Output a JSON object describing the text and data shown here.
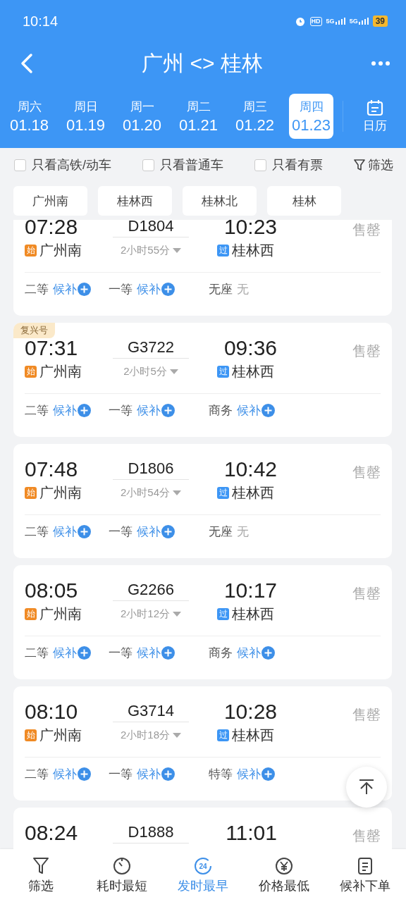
{
  "status_bar": {
    "time": "10:14",
    "icons": [
      {
        "kind": "alarm"
      },
      {
        "kind": "hd",
        "text": "HD"
      },
      {
        "kind": "signal",
        "text": "5G"
      },
      {
        "kind": "signal",
        "text": "5G"
      }
    ],
    "battery": "39"
  },
  "header": {
    "title": "广州 <> 桂林"
  },
  "dates": [
    {
      "weekday": "周六",
      "date": "01.18",
      "selected": false
    },
    {
      "weekday": "周日",
      "date": "01.19",
      "selected": false
    },
    {
      "weekday": "周一",
      "date": "01.20",
      "selected": false
    },
    {
      "weekday": "周二",
      "date": "01.21",
      "selected": false
    },
    {
      "weekday": "周三",
      "date": "01.22",
      "selected": false
    },
    {
      "weekday": "周四",
      "date": "01.23",
      "selected": true
    }
  ],
  "calendar_button": {
    "label": "日历"
  },
  "filters": [
    {
      "label": "只看高铁/动车",
      "checked": false
    },
    {
      "label": "只看普通车",
      "checked": false
    },
    {
      "label": "只看有票",
      "checked": false
    }
  ],
  "filter_button": {
    "label": "筛选"
  },
  "stations": [
    "广州南",
    "桂林西",
    "桂林北",
    "桂林"
  ],
  "trains": [
    {
      "dep_time": "07:28",
      "train_no": "D1804",
      "arr_time": "10:23",
      "status": "售罄",
      "from_tag": "始",
      "from_station": "广州南",
      "duration": "2小时55分",
      "to_tag": "过",
      "to_station": "桂林西",
      "seats": [
        {
          "class": "二等",
          "status": "候补",
          "kind": "waitlist"
        },
        {
          "class": "一等",
          "status": "候补",
          "kind": "waitlist"
        },
        {
          "class": "无座",
          "status": "无",
          "kind": "none"
        }
      ]
    },
    {
      "badge": "复兴号",
      "dep_time": "07:31",
      "train_no": "G3722",
      "arr_time": "09:36",
      "status": "售罄",
      "from_tag": "始",
      "from_station": "广州南",
      "duration": "2小时5分",
      "to_tag": "过",
      "to_station": "桂林西",
      "seats": [
        {
          "class": "二等",
          "status": "候补",
          "kind": "waitlist"
        },
        {
          "class": "一等",
          "status": "候补",
          "kind": "waitlist"
        },
        {
          "class": "商务",
          "status": "候补",
          "kind": "waitlist"
        }
      ]
    },
    {
      "dep_time": "07:48",
      "train_no": "D1806",
      "arr_time": "10:42",
      "status": "售罄",
      "from_tag": "始",
      "from_station": "广州南",
      "duration": "2小时54分",
      "to_tag": "过",
      "to_station": "桂林西",
      "seats": [
        {
          "class": "二等",
          "status": "候补",
          "kind": "waitlist"
        },
        {
          "class": "一等",
          "status": "候补",
          "kind": "waitlist"
        },
        {
          "class": "无座",
          "status": "无",
          "kind": "none"
        }
      ]
    },
    {
      "dep_time": "08:05",
      "train_no": "G2266",
      "arr_time": "10:17",
      "status": "售罄",
      "from_tag": "始",
      "from_station": "广州南",
      "duration": "2小时12分",
      "to_tag": "过",
      "to_station": "桂林西",
      "seats": [
        {
          "class": "二等",
          "status": "候补",
          "kind": "waitlist"
        },
        {
          "class": "一等",
          "status": "候补",
          "kind": "waitlist"
        },
        {
          "class": "商务",
          "status": "候补",
          "kind": "waitlist"
        }
      ]
    },
    {
      "dep_time": "08:10",
      "train_no": "G3714",
      "arr_time": "10:28",
      "status": "售罄",
      "from_tag": "始",
      "from_station": "广州南",
      "duration": "2小时18分",
      "to_tag": "过",
      "to_station": "桂林西",
      "seats": [
        {
          "class": "二等",
          "status": "候补",
          "kind": "waitlist"
        },
        {
          "class": "一等",
          "status": "候补",
          "kind": "waitlist"
        },
        {
          "class": "特等",
          "status": "候补",
          "kind": "waitlist"
        }
      ]
    },
    {
      "dep_time": "08:24",
      "train_no": "D1888",
      "arr_time": "11:01",
      "status": "售罄"
    }
  ],
  "bottom_nav": [
    {
      "label": "筛选",
      "kind": "filter",
      "selected": false
    },
    {
      "label": "耗时最短",
      "kind": "timer",
      "selected": false
    },
    {
      "label": "发时最早",
      "kind": "clock24",
      "icon_text": "24",
      "selected": true
    },
    {
      "label": "价格最低",
      "kind": "price",
      "selected": false
    },
    {
      "label": "候补下单",
      "kind": "waitlist",
      "selected": false
    }
  ]
}
